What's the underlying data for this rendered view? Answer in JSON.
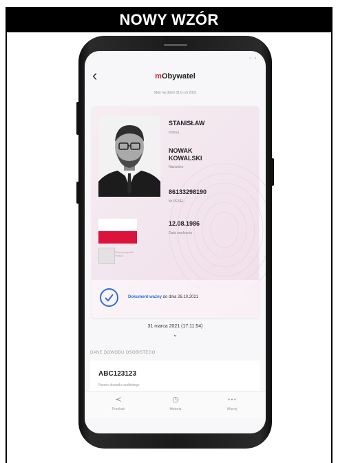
{
  "banner": {
    "title": "NOWY WZÓR"
  },
  "status_bar": {
    "icons": "▫ ▪"
  },
  "header": {
    "back_icon": "‹",
    "app_name_prefix": "m",
    "app_name_rest": "Obywatel",
    "subtitle": "Stan na dzień 31 b.r./y 2021"
  },
  "id_card": {
    "first_name": "STANISŁAW",
    "first_name_label": "Imiona",
    "last_name_1": "NOWAK",
    "last_name_2": "KOWALSKI",
    "last_name_label": "Nazwisko",
    "pesel": "86133298190",
    "pesel_label": "Nr PESEL",
    "birth_date": "12.08.1986",
    "birth_date_label": "Data urodzenia",
    "emblem_caption": "Rzeczpospolita Polska",
    "flag_colors": {
      "top": "#ffffff",
      "bottom": "#dc143c"
    }
  },
  "validity": {
    "link_text": "Dokument ważny",
    "rest_text": " do dnia 26.10.2021",
    "accent_color": "#2b6fd6"
  },
  "timestamp": {
    "text": "31 marca 2021 (17:11:54)",
    "chevron": "⌄"
  },
  "section": {
    "title": "DANE DOWODU OSOBISTEGO"
  },
  "document": {
    "number": "ABC123123",
    "label": "Numer dowodu osobistego"
  },
  "nav": {
    "items": [
      {
        "icon": "share-icon",
        "glyph": "≺",
        "label": "Przekaż"
      },
      {
        "icon": "history-icon",
        "glyph": "◷",
        "label": "Historia"
      },
      {
        "icon": "more-icon",
        "glyph": "• • •",
        "label": "Więcej"
      }
    ]
  }
}
